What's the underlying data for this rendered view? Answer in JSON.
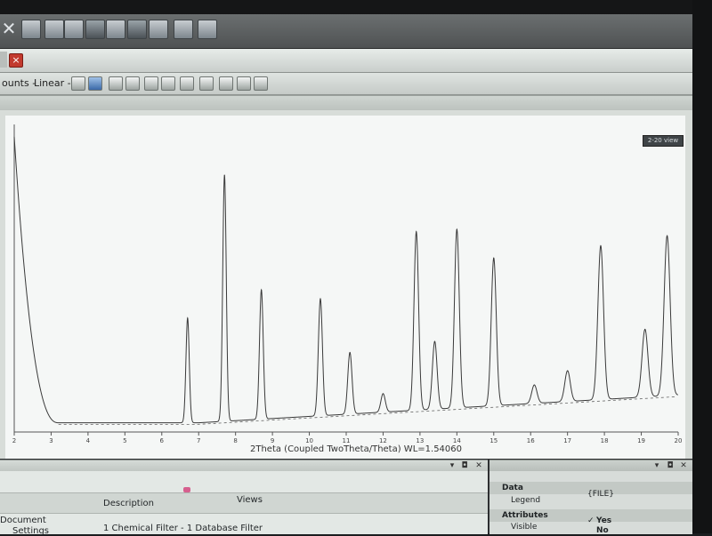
{
  "toolbar1": {
    "icons": [
      "close-icon",
      "open-icon",
      "copy-icon",
      "chart-icon",
      "grid-icon",
      "table-icon",
      "window-icon",
      "link-icon",
      "export-icon"
    ]
  },
  "tab": {
    "close_glyph": "×"
  },
  "toolbar2": {
    "counts_label": "ounts -",
    "scale_label": "Linear -"
  },
  "plot": {
    "range_badge": "2-20 view",
    "x_axis_label": "2Theta (Coupled TwoTheta/Theta) WL=1.54060"
  },
  "chart_data": {
    "type": "line",
    "xlabel": "2Theta (Coupled TwoTheta/Theta) WL=1.54060",
    "xlim": [
      2,
      20
    ],
    "x_ticks": [
      "2",
      "3",
      "4",
      "5",
      "6",
      "7",
      "8",
      "9",
      "10",
      "11",
      "12",
      "13",
      "14",
      "15",
      "16",
      "17",
      "18",
      "19",
      "20"
    ],
    "background": {
      "start_height": 0.96,
      "flat_after": 3.2,
      "baseline": 0.03
    },
    "peaks": [
      {
        "x": 6.7,
        "h": 0.34
      },
      {
        "x": 7.7,
        "h": 0.8
      },
      {
        "x": 8.7,
        "h": 0.42
      },
      {
        "x": 10.3,
        "h": 0.38
      },
      {
        "x": 11.1,
        "h": 0.2
      },
      {
        "x": 12.0,
        "h": 0.06
      },
      {
        "x": 12.9,
        "h": 0.58
      },
      {
        "x": 13.4,
        "h": 0.22
      },
      {
        "x": 14.0,
        "h": 0.58
      },
      {
        "x": 15.0,
        "h": 0.48
      },
      {
        "x": 16.1,
        "h": 0.06
      },
      {
        "x": 17.0,
        "h": 0.1
      },
      {
        "x": 17.9,
        "h": 0.5
      },
      {
        "x": 19.1,
        "h": 0.22
      },
      {
        "x": 19.7,
        "h": 0.52
      }
    ]
  },
  "bottom_left": {
    "col_description": "Description",
    "col_views": "Views",
    "row1_name": "Document",
    "row2_name": "Settings",
    "row2_desc": "1 Chemical Filter - 1 Database Filter"
  },
  "bottom_right": {
    "data_heading": "Data",
    "legend_label": "Legend",
    "legend_value": "{FILE}",
    "attributes_heading": "Attributes",
    "visible_label": "Visible",
    "visible_value": "Yes",
    "no_value": "No",
    "check_glyph": "✓"
  }
}
